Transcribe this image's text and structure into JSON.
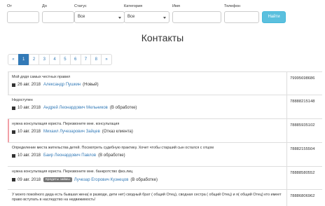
{
  "filters": {
    "from_label": "От",
    "to_label": "До",
    "status_label": "Статус",
    "status_value": "Все",
    "category_label": "Категория",
    "category_value": "Все",
    "name_label": "Имя",
    "phone_label": "Телефон",
    "submit_label": "Найти"
  },
  "page_title": "Контакты",
  "pagination": [
    "«",
    "1",
    "2",
    "3",
    "4",
    "5",
    "6",
    "7",
    "8",
    "»"
  ],
  "rows": [
    {
      "desc": "Мой дядя самых честных правил",
      "date": "26 авг. 2018",
      "name": "Александр Пушкин",
      "status": "(Новый)",
      "phone": "79995698686"
    },
    {
      "desc": "Недоступен",
      "date": "10 авг. 2018",
      "name": "Андрей Леонардович Мельников",
      "status": "(В обработке)",
      "phone": "78888215148"
    },
    {
      "desc": "нужна консультация юриста. Перезвоните мне. консультация",
      "date": "10 авг. 2018",
      "name": "Михаил Лучезарович Зайцев",
      "status": "(Отказ клиента)",
      "phone": "78885935102"
    },
    {
      "desc": "Определение места жительства детей. Посмотреть судебную практику. Хочет чтобы старший сын остался с отцом",
      "date": "10 авг. 2018",
      "name": "Баир Леонардович Павлов",
      "status": "(В обработке)",
      "phone": "78882155504"
    },
    {
      "desc": "нужна консультация юриста. Перезвоните мне. банкротство физ.лиц",
      "date": "09 авг. 2018",
      "badge": "Кредиты займы",
      "name": "Лучезар Егорович Кузнецов",
      "status": "(В обработке)",
      "phone": "78888580552"
    },
    {
      "desc": "У моего покойного деда есть бывшая жена( в разводе, дети нет) сводный брат ( общий Отец), сводная сестра ( общий Отец) и я( общий Отец) кто имеет право вступать в наследство на недвижимость!",
      "phone": "78886806962"
    }
  ]
}
